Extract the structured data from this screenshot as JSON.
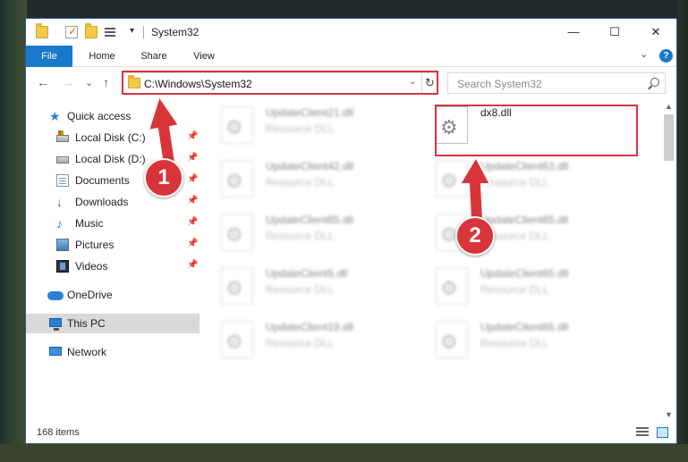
{
  "window": {
    "title": "System32",
    "minimize_glyph": "—",
    "maximize_glyph": "☐",
    "close_glyph": "✕"
  },
  "ribbon": {
    "tabs": [
      {
        "label": "File"
      },
      {
        "label": "Home"
      },
      {
        "label": "Share"
      },
      {
        "label": "View"
      }
    ],
    "chevron": "⌄",
    "help": "?"
  },
  "nav": {
    "back": "←",
    "forward": "→",
    "recent": "⌄",
    "up": "↑",
    "address": "C:\\Windows\\System32",
    "address_dropdown": "⌄",
    "refresh": "↻",
    "search_placeholder": "Search System32"
  },
  "sidebar": {
    "items": [
      {
        "label": "Quick access",
        "icon": "star-icon"
      },
      {
        "label": "Local Disk (C:)",
        "icon": "drive-icon",
        "pinned": true
      },
      {
        "label": "Local Disk (D:)",
        "icon": "drive-icon",
        "pinned": true
      },
      {
        "label": "Documents",
        "icon": "documents-icon",
        "pinned": true
      },
      {
        "label": "Downloads",
        "icon": "download-icon",
        "pinned": true
      },
      {
        "label": "Music",
        "icon": "music-icon",
        "pinned": true
      },
      {
        "label": "Pictures",
        "icon": "pictures-icon",
        "pinned": true
      },
      {
        "label": "Videos",
        "icon": "videos-icon",
        "pinned": true
      },
      {
        "label": "OneDrive",
        "icon": "cloud-icon"
      },
      {
        "label": "This PC",
        "icon": "computer-icon",
        "selected": true
      },
      {
        "label": "Network",
        "icon": "network-icon"
      }
    ],
    "pin_glyph": "📌"
  },
  "files": [
    {
      "name": "UpdateClient21.dll",
      "type": "Resource DLL"
    },
    {
      "name": "dx8.dll",
      "type": ""
    },
    {
      "name": "UpdateClient42.dll",
      "type": "Resource DLL"
    },
    {
      "name": "UpdateClient63.dll",
      "type": "Resource DLL"
    },
    {
      "name": "UpdateClient65.dll",
      "type": "Resource DLL"
    },
    {
      "name": "UpdateClient65.dll",
      "type": "Resource DLL"
    },
    {
      "name": "UpdateClient5.dll",
      "type": "Resource DLL"
    },
    {
      "name": "UpdateClient65.dll",
      "type": "Resource DLL"
    },
    {
      "name": "UpdateClient19.dll",
      "type": "Resource DLL"
    },
    {
      "name": "UpdateClient65.dll",
      "type": "Resource DLL"
    }
  ],
  "status": {
    "item_count": "168 items"
  },
  "annotations": {
    "step1": "1",
    "step2": "2",
    "color": "#d8353b"
  }
}
